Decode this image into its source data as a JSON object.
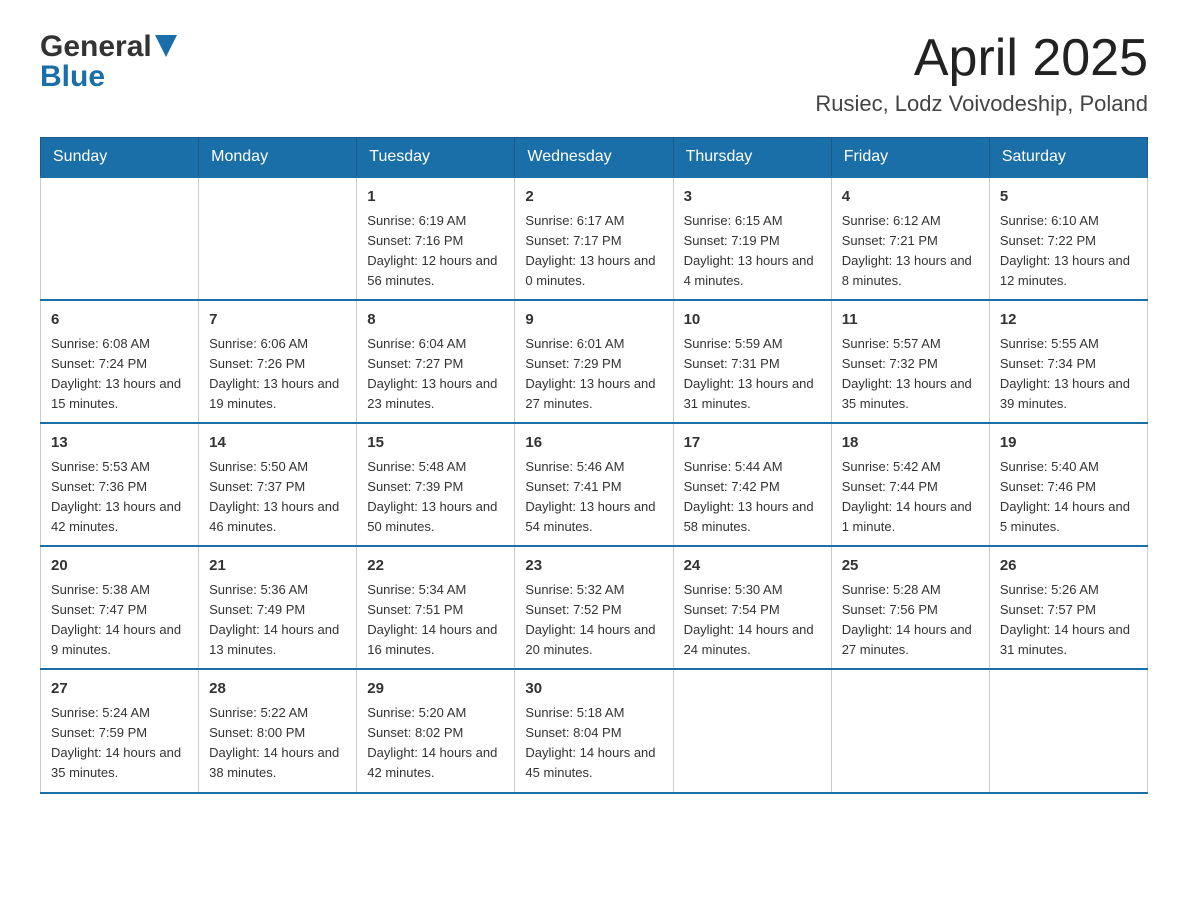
{
  "header": {
    "month_title": "April 2025",
    "location": "Rusiec, Lodz Voivodeship, Poland",
    "logo_general": "General",
    "logo_blue": "Blue"
  },
  "weekdays": [
    "Sunday",
    "Monday",
    "Tuesday",
    "Wednesday",
    "Thursday",
    "Friday",
    "Saturday"
  ],
  "weeks": [
    [
      {
        "day": "",
        "sunrise": "",
        "sunset": "",
        "daylight": ""
      },
      {
        "day": "",
        "sunrise": "",
        "sunset": "",
        "daylight": ""
      },
      {
        "day": "1",
        "sunrise": "Sunrise: 6:19 AM",
        "sunset": "Sunset: 7:16 PM",
        "daylight": "Daylight: 12 hours and 56 minutes."
      },
      {
        "day": "2",
        "sunrise": "Sunrise: 6:17 AM",
        "sunset": "Sunset: 7:17 PM",
        "daylight": "Daylight: 13 hours and 0 minutes."
      },
      {
        "day": "3",
        "sunrise": "Sunrise: 6:15 AM",
        "sunset": "Sunset: 7:19 PM",
        "daylight": "Daylight: 13 hours and 4 minutes."
      },
      {
        "day": "4",
        "sunrise": "Sunrise: 6:12 AM",
        "sunset": "Sunset: 7:21 PM",
        "daylight": "Daylight: 13 hours and 8 minutes."
      },
      {
        "day": "5",
        "sunrise": "Sunrise: 6:10 AM",
        "sunset": "Sunset: 7:22 PM",
        "daylight": "Daylight: 13 hours and 12 minutes."
      }
    ],
    [
      {
        "day": "6",
        "sunrise": "Sunrise: 6:08 AM",
        "sunset": "Sunset: 7:24 PM",
        "daylight": "Daylight: 13 hours and 15 minutes."
      },
      {
        "day": "7",
        "sunrise": "Sunrise: 6:06 AM",
        "sunset": "Sunset: 7:26 PM",
        "daylight": "Daylight: 13 hours and 19 minutes."
      },
      {
        "day": "8",
        "sunrise": "Sunrise: 6:04 AM",
        "sunset": "Sunset: 7:27 PM",
        "daylight": "Daylight: 13 hours and 23 minutes."
      },
      {
        "day": "9",
        "sunrise": "Sunrise: 6:01 AM",
        "sunset": "Sunset: 7:29 PM",
        "daylight": "Daylight: 13 hours and 27 minutes."
      },
      {
        "day": "10",
        "sunrise": "Sunrise: 5:59 AM",
        "sunset": "Sunset: 7:31 PM",
        "daylight": "Daylight: 13 hours and 31 minutes."
      },
      {
        "day": "11",
        "sunrise": "Sunrise: 5:57 AM",
        "sunset": "Sunset: 7:32 PM",
        "daylight": "Daylight: 13 hours and 35 minutes."
      },
      {
        "day": "12",
        "sunrise": "Sunrise: 5:55 AM",
        "sunset": "Sunset: 7:34 PM",
        "daylight": "Daylight: 13 hours and 39 minutes."
      }
    ],
    [
      {
        "day": "13",
        "sunrise": "Sunrise: 5:53 AM",
        "sunset": "Sunset: 7:36 PM",
        "daylight": "Daylight: 13 hours and 42 minutes."
      },
      {
        "day": "14",
        "sunrise": "Sunrise: 5:50 AM",
        "sunset": "Sunset: 7:37 PM",
        "daylight": "Daylight: 13 hours and 46 minutes."
      },
      {
        "day": "15",
        "sunrise": "Sunrise: 5:48 AM",
        "sunset": "Sunset: 7:39 PM",
        "daylight": "Daylight: 13 hours and 50 minutes."
      },
      {
        "day": "16",
        "sunrise": "Sunrise: 5:46 AM",
        "sunset": "Sunset: 7:41 PM",
        "daylight": "Daylight: 13 hours and 54 minutes."
      },
      {
        "day": "17",
        "sunrise": "Sunrise: 5:44 AM",
        "sunset": "Sunset: 7:42 PM",
        "daylight": "Daylight: 13 hours and 58 minutes."
      },
      {
        "day": "18",
        "sunrise": "Sunrise: 5:42 AM",
        "sunset": "Sunset: 7:44 PM",
        "daylight": "Daylight: 14 hours and 1 minute."
      },
      {
        "day": "19",
        "sunrise": "Sunrise: 5:40 AM",
        "sunset": "Sunset: 7:46 PM",
        "daylight": "Daylight: 14 hours and 5 minutes."
      }
    ],
    [
      {
        "day": "20",
        "sunrise": "Sunrise: 5:38 AM",
        "sunset": "Sunset: 7:47 PM",
        "daylight": "Daylight: 14 hours and 9 minutes."
      },
      {
        "day": "21",
        "sunrise": "Sunrise: 5:36 AM",
        "sunset": "Sunset: 7:49 PM",
        "daylight": "Daylight: 14 hours and 13 minutes."
      },
      {
        "day": "22",
        "sunrise": "Sunrise: 5:34 AM",
        "sunset": "Sunset: 7:51 PM",
        "daylight": "Daylight: 14 hours and 16 minutes."
      },
      {
        "day": "23",
        "sunrise": "Sunrise: 5:32 AM",
        "sunset": "Sunset: 7:52 PM",
        "daylight": "Daylight: 14 hours and 20 minutes."
      },
      {
        "day": "24",
        "sunrise": "Sunrise: 5:30 AM",
        "sunset": "Sunset: 7:54 PM",
        "daylight": "Daylight: 14 hours and 24 minutes."
      },
      {
        "day": "25",
        "sunrise": "Sunrise: 5:28 AM",
        "sunset": "Sunset: 7:56 PM",
        "daylight": "Daylight: 14 hours and 27 minutes."
      },
      {
        "day": "26",
        "sunrise": "Sunrise: 5:26 AM",
        "sunset": "Sunset: 7:57 PM",
        "daylight": "Daylight: 14 hours and 31 minutes."
      }
    ],
    [
      {
        "day": "27",
        "sunrise": "Sunrise: 5:24 AM",
        "sunset": "Sunset: 7:59 PM",
        "daylight": "Daylight: 14 hours and 35 minutes."
      },
      {
        "day": "28",
        "sunrise": "Sunrise: 5:22 AM",
        "sunset": "Sunset: 8:00 PM",
        "daylight": "Daylight: 14 hours and 38 minutes."
      },
      {
        "day": "29",
        "sunrise": "Sunrise: 5:20 AM",
        "sunset": "Sunset: 8:02 PM",
        "daylight": "Daylight: 14 hours and 42 minutes."
      },
      {
        "day": "30",
        "sunrise": "Sunrise: 5:18 AM",
        "sunset": "Sunset: 8:04 PM",
        "daylight": "Daylight: 14 hours and 45 minutes."
      },
      {
        "day": "",
        "sunrise": "",
        "sunset": "",
        "daylight": ""
      },
      {
        "day": "",
        "sunrise": "",
        "sunset": "",
        "daylight": ""
      },
      {
        "day": "",
        "sunrise": "",
        "sunset": "",
        "daylight": ""
      }
    ]
  ]
}
